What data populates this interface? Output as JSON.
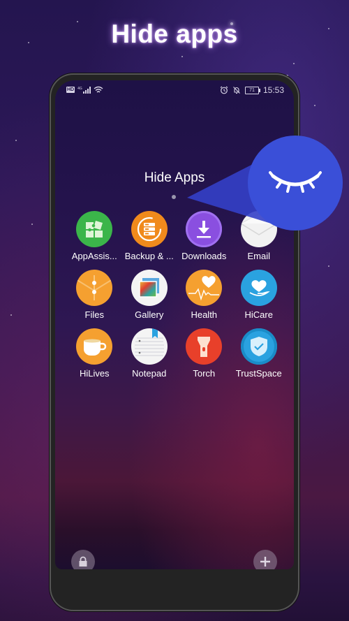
{
  "headline": "Hide apps",
  "status_bar": {
    "left_icons": [
      "hd-icon",
      "4g-signal-icon",
      "wifi-icon"
    ],
    "hd_label": "HD",
    "network_label": "4G",
    "right_icons": [
      "alarm-icon",
      "mute-icon",
      "battery-icon"
    ],
    "battery_level": "71",
    "time": "15:53"
  },
  "folder": {
    "title": "Hide Apps",
    "page_indicator": {
      "current": 1,
      "total": 1
    }
  },
  "apps": [
    {
      "label": "AppAssis...",
      "icon": "puzzle-icon",
      "color": "#3bb54a"
    },
    {
      "label": "Backup & ...",
      "icon": "backup-icon",
      "color": "#f08a1c"
    },
    {
      "label": "Downloads",
      "icon": "download-icon",
      "color": "#8a4fe0"
    },
    {
      "label": "Email",
      "icon": "envelope-icon",
      "color": "#f2f2f2"
    },
    {
      "label": "Files",
      "icon": "folder-envelope-icon",
      "color": "#f5a030"
    },
    {
      "label": "Gallery",
      "icon": "gallery-icon",
      "color": "#f4f4f4"
    },
    {
      "label": "Health",
      "icon": "heart-pulse-icon",
      "color": "#f5a030"
    },
    {
      "label": "HiCare",
      "icon": "heart-hand-icon",
      "color": "#2aa2e0"
    },
    {
      "label": "HiLives",
      "icon": "coffee-cup-icon",
      "color": "#f5a030"
    },
    {
      "label": "Notepad",
      "icon": "notepad-icon",
      "color": "#f4f4f4"
    },
    {
      "label": "Torch",
      "icon": "torch-icon",
      "color": "#e8402a"
    },
    {
      "label": "TrustSpace",
      "icon": "shield-check-icon",
      "color": "#2aa2e0"
    }
  ],
  "bottom_actions": {
    "lock": "lock-icon",
    "add": "plus-icon"
  },
  "callout": {
    "icon": "closed-eye-icon",
    "color": "#3a4fd8"
  }
}
